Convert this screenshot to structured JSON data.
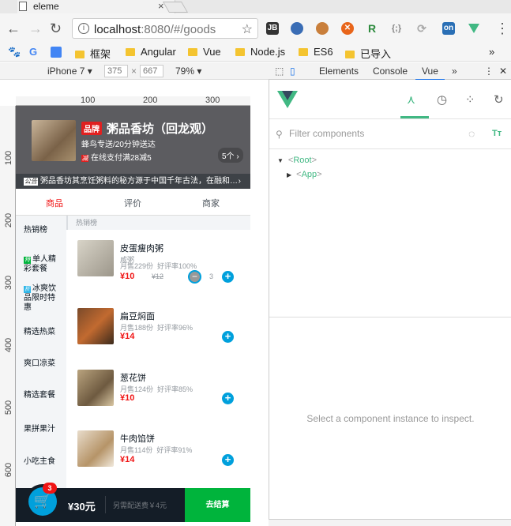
{
  "browser": {
    "tab_title": "eleme",
    "url_host": "localhost",
    "url_rest": ":8080/#/goods",
    "bookmarks": [
      "框架",
      "Angular",
      "Vue",
      "Node.js",
      "ES6",
      "已导入"
    ],
    "ext_on_label": "on"
  },
  "device": {
    "model": "iPhone 7",
    "width": "375",
    "height": "667",
    "zoom": "79%"
  },
  "devtools_tabs": [
    "Elements",
    "Console",
    "Vue"
  ],
  "ruler": {
    "top": [
      "100",
      "200",
      "300"
    ],
    "left": [
      "100",
      "200",
      "300",
      "400",
      "500",
      "600"
    ]
  },
  "seller": {
    "brand": "品牌",
    "name": "粥品香坊（回龙观）",
    "description": "蜂鸟专送/20分钟送达",
    "support_icon": "减",
    "support": "在线支付满28减5",
    "count": "5个 ›",
    "bulletin_tag": "公告",
    "bulletin": "粥品香坊其烹饪粥料的秘方源于中国千年古法，在融和…",
    "bulletin_arrow": "›"
  },
  "nav_tabs": [
    "商品",
    "评价",
    "商家"
  ],
  "menu": [
    {
      "icon": "",
      "label": "热销榜"
    },
    {
      "icon": "特",
      "label": "单人精彩套餐",
      "color": "#00b43c"
    },
    {
      "icon": "折",
      "label": "冰爽饮品限时特惠",
      "color": "#2fb6e8"
    },
    {
      "icon": "",
      "label": "精选热菜"
    },
    {
      "icon": "",
      "label": "爽口凉菜"
    },
    {
      "icon": "",
      "label": "精选套餐"
    },
    {
      "icon": "",
      "label": "果拼果汁"
    },
    {
      "icon": "",
      "label": "小吃主食"
    }
  ],
  "food_section_title": "热销榜",
  "foods": [
    {
      "name": "皮蛋瘦肉粥",
      "description": "咸粥",
      "sell": "月售229份",
      "rating": "好评率100%",
      "price": "¥10",
      "old_price": "¥12",
      "count": "3"
    },
    {
      "name": "扁豆焖面",
      "description": "",
      "sell": "月售188份",
      "rating": "好评率96%",
      "price": "¥14",
      "old_price": ""
    },
    {
      "name": "葱花饼",
      "description": "",
      "sell": "月售124份",
      "rating": "好评率85%",
      "price": "¥10",
      "old_price": ""
    },
    {
      "name": "牛肉馅饼",
      "description": "",
      "sell": "月售114份",
      "rating": "好评率91%",
      "price": "¥14",
      "old_price": ""
    }
  ],
  "shopcart": {
    "badge": "3",
    "total": "¥30元",
    "delivery": "另需配送费￥4元",
    "pay": "去结算"
  },
  "vue": {
    "filter_placeholder": "Filter components",
    "root_label": "Root",
    "app_label": "App",
    "inspect_msg": "Select a component instance to inspect."
  },
  "colors": {
    "accent": "#00a0dc",
    "red": "#f01414",
    "vue_green": "#41b883",
    "pay_green": "#00b43c"
  }
}
